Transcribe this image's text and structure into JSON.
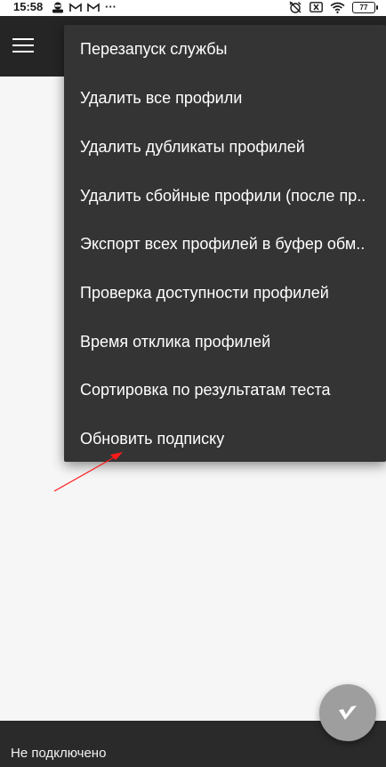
{
  "status_bar": {
    "time": "15:58",
    "battery": "77",
    "dots": "···"
  },
  "menu": {
    "items": [
      "Перезапуск службы",
      "Удалить все профили",
      "Удалить дубликаты профилей",
      "Удалить сбойные профили (после пр..",
      "Экспорт всех профилей в буфер обм..",
      "Проверка доступности профилей",
      "Время отклика профилей",
      "Сортировка по результатам теста",
      "Обновить подписку"
    ]
  },
  "bottom_bar": {
    "status": "Не подключено"
  },
  "colors": {
    "appbar": "#252525",
    "menu_bg": "#343434",
    "fab": "#9e9e9e",
    "annotation_arrow": "#ff0000"
  },
  "icons": {
    "menu": "hamburger-icon",
    "fab": "v-logo-icon"
  }
}
